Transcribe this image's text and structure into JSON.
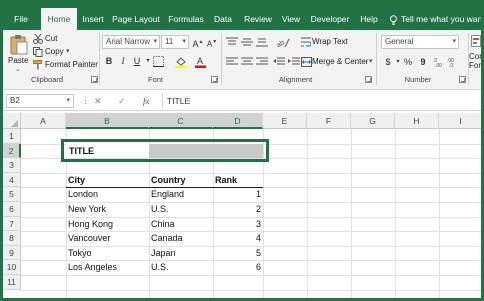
{
  "ribbon_tabs": [
    "File",
    "Home",
    "Insert",
    "Page Layout",
    "Formulas",
    "Data",
    "Review",
    "View",
    "Developer",
    "Help"
  ],
  "active_tab": "Home",
  "tell_me": "Tell me what you want",
  "clipboard": {
    "paste": "Paste",
    "cut": "Cut",
    "copy": "Copy",
    "format_painter": "Format Painter",
    "label": "Clipboard"
  },
  "font": {
    "name": "Arial Narrow",
    "size": "11",
    "label": "Font"
  },
  "alignment": {
    "wrap_text": "Wrap Text",
    "merge_center": "Merge & Center",
    "label": "Alignment"
  },
  "number": {
    "format": "General",
    "label": "Number"
  },
  "styles_partial": "Conc",
  "styles_partial2": "Form",
  "formula_bar": {
    "name_box": "B2",
    "formula": "TITLE"
  },
  "columns": [
    "A",
    "B",
    "C",
    "D",
    "E",
    "F",
    "G",
    "H",
    "I"
  ],
  "rows": [
    "1",
    "2",
    "3",
    "4",
    "5",
    "6",
    "7",
    "8",
    "9",
    "10",
    "11"
  ],
  "sheet": {
    "title": "TITLE",
    "headers": [
      "City",
      "Country",
      "Rank"
    ],
    "data": [
      {
        "city": "London",
        "country": "England",
        "rank": "1"
      },
      {
        "city": "New York",
        "country": "U.S.",
        "rank": "2"
      },
      {
        "city": "Hong Kong",
        "country": "China",
        "rank": "3"
      },
      {
        "city": "Vancouver",
        "country": "Canada",
        "rank": "4"
      },
      {
        "city": "Tokyo",
        "country": "Japan",
        "rank": "5"
      },
      {
        "city": "Los Angeles",
        "country": "U.S.",
        "rank": "6"
      }
    ]
  },
  "colors": {
    "accent": "#217346",
    "title_fill": "#c9c9c9"
  }
}
